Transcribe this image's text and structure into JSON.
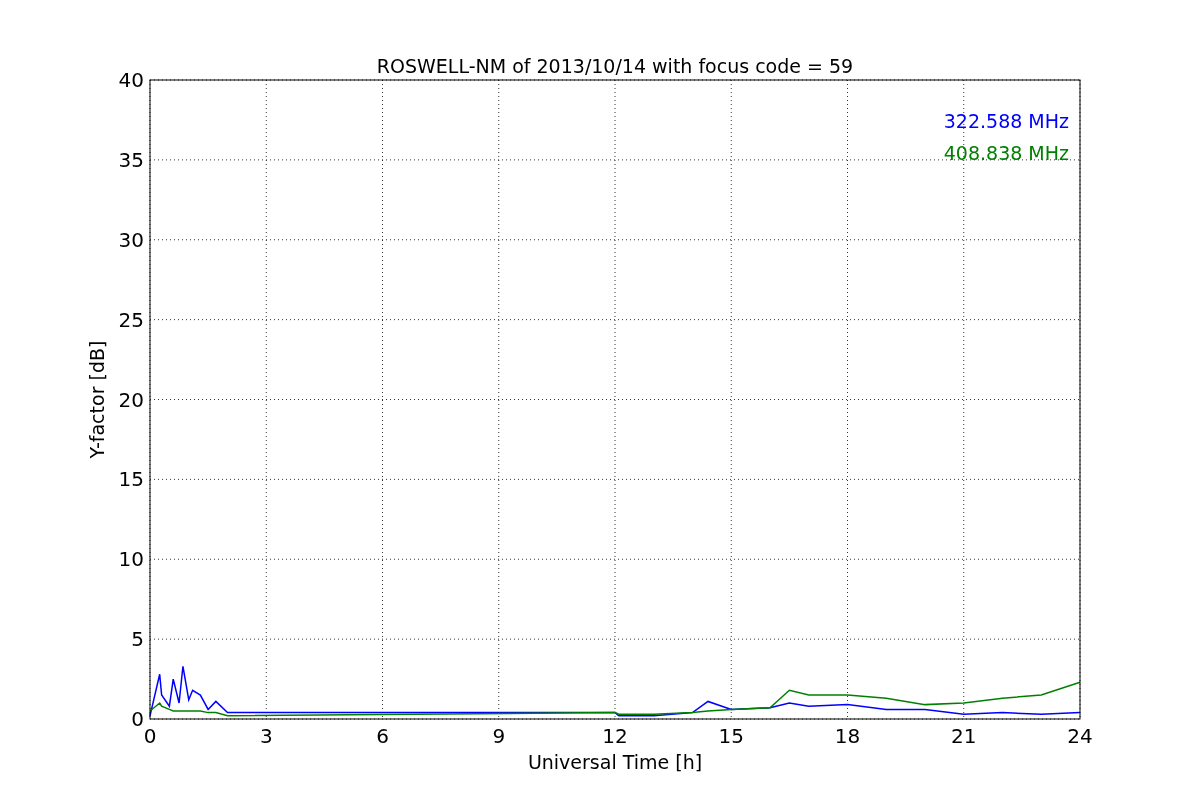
{
  "figure": {
    "chart_data": {
      "type": "line",
      "title": "ROSWELL-NM of 2013/10/14 with focus code = 59",
      "xlabel": "Universal Time [h]",
      "ylabel": "Y-factor [dB]",
      "grid": true,
      "xlim": [
        0,
        24
      ],
      "ylim": [
        0,
        40
      ],
      "xticks": [
        0,
        3,
        6,
        9,
        12,
        15,
        18,
        21,
        24
      ],
      "yticks": [
        0,
        5,
        10,
        15,
        20,
        25,
        30,
        35,
        40
      ],
      "x": [
        0,
        0.25,
        0.3,
        0.5,
        0.6,
        0.75,
        0.85,
        1,
        1.1,
        1.3,
        1.5,
        1.7,
        2,
        12,
        12.1,
        13,
        14,
        14.4,
        15,
        16,
        16.5,
        17,
        18,
        19,
        20,
        21,
        22,
        23,
        24
      ],
      "series": [
        {
          "name": "322.588 MHz",
          "color": "#0000ff",
          "values": [
            0.2,
            2.8,
            1.5,
            0.8,
            2.5,
            1.0,
            3.3,
            1.2,
            1.8,
            1.5,
            0.6,
            1.1,
            0.4,
            0.4,
            0.2,
            0.2,
            0.4,
            1.1,
            0.6,
            0.7,
            1.0,
            0.8,
            0.9,
            0.6,
            0.6,
            0.3,
            0.4,
            0.3,
            0.4
          ]
        },
        {
          "name": "408.838 MHz",
          "color": "#008000",
          "values": [
            0.5,
            1.0,
            0.8,
            0.6,
            0.5,
            0.5,
            0.5,
            0.5,
            0.5,
            0.5,
            0.4,
            0.4,
            0.2,
            0.4,
            0.3,
            0.3,
            0.4,
            0.5,
            0.6,
            0.7,
            1.8,
            1.5,
            1.5,
            1.3,
            0.9,
            1.0,
            1.3,
            1.5,
            2.3
          ]
        }
      ]
    }
  }
}
